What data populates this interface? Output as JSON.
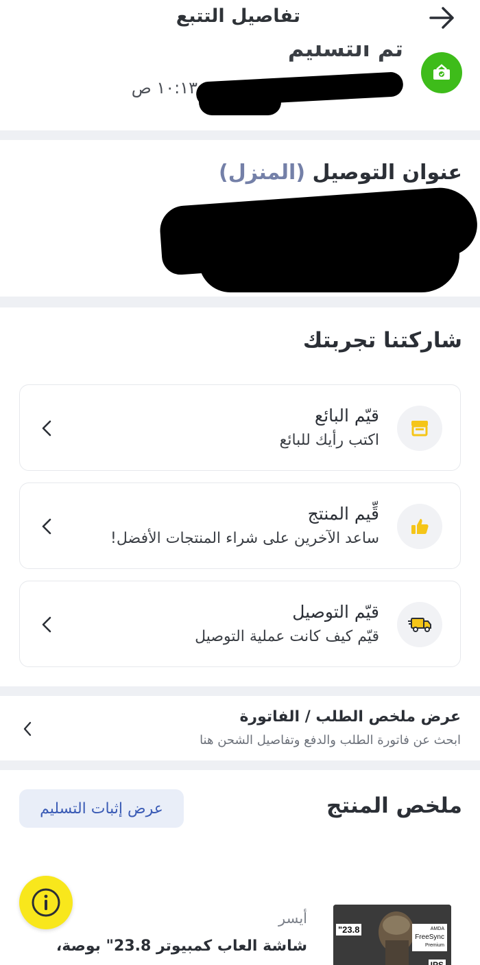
{
  "header": {
    "title": "تفاصيل التتبع",
    "back_icon": "arrow-right-icon"
  },
  "status": {
    "label": "تم التسليم",
    "time": "١٠:١٣ ص",
    "icon": "delivered-package-icon",
    "icon_color": "#3ebc1a"
  },
  "address": {
    "title": "عنوان التوصيل",
    "tag": "(المنزل)"
  },
  "experience": {
    "title": "شاركتنا تجربتك",
    "items": [
      {
        "title": "قيّم البائع",
        "subtitle": "اكتب رأيك للبائع",
        "icon": "store-icon"
      },
      {
        "title": "قِّيم المنتج",
        "subtitle": "ساعد الآخرين على شراء المنتجات الأفضل!",
        "icon": "thumbs-up-icon"
      },
      {
        "title": "قيّم التوصيل",
        "subtitle": "قيّم كيف كانت عملية التوصيل",
        "icon": "delivery-truck-icon"
      }
    ]
  },
  "invoice": {
    "title": "عرض ملخص الطلب / الفاتورة",
    "subtitle": "ابحث عن فاتورة الطلب والدفع وتفاصيل الشحن هنا"
  },
  "product_summary": {
    "title": "ملخص المنتج",
    "proof_button": "عرض إثبات التسليم",
    "brand": "أيسر",
    "name": "شاشة العاب كمبيوتر 23.8\" بوصة،",
    "thumb_size": "23.8\"",
    "thumb_badge_brand": "AMDA",
    "thumb_badge": "FreeSync",
    "thumb_badge_sub": "Premium",
    "thumb_panel": "IPS"
  },
  "fab": {
    "icon": "info-icon",
    "color": "#f8e71c"
  },
  "colors": {
    "accent_yellow": "#f8e71c",
    "green": "#3ebc1a",
    "link_blue": "#3a5bb5"
  }
}
